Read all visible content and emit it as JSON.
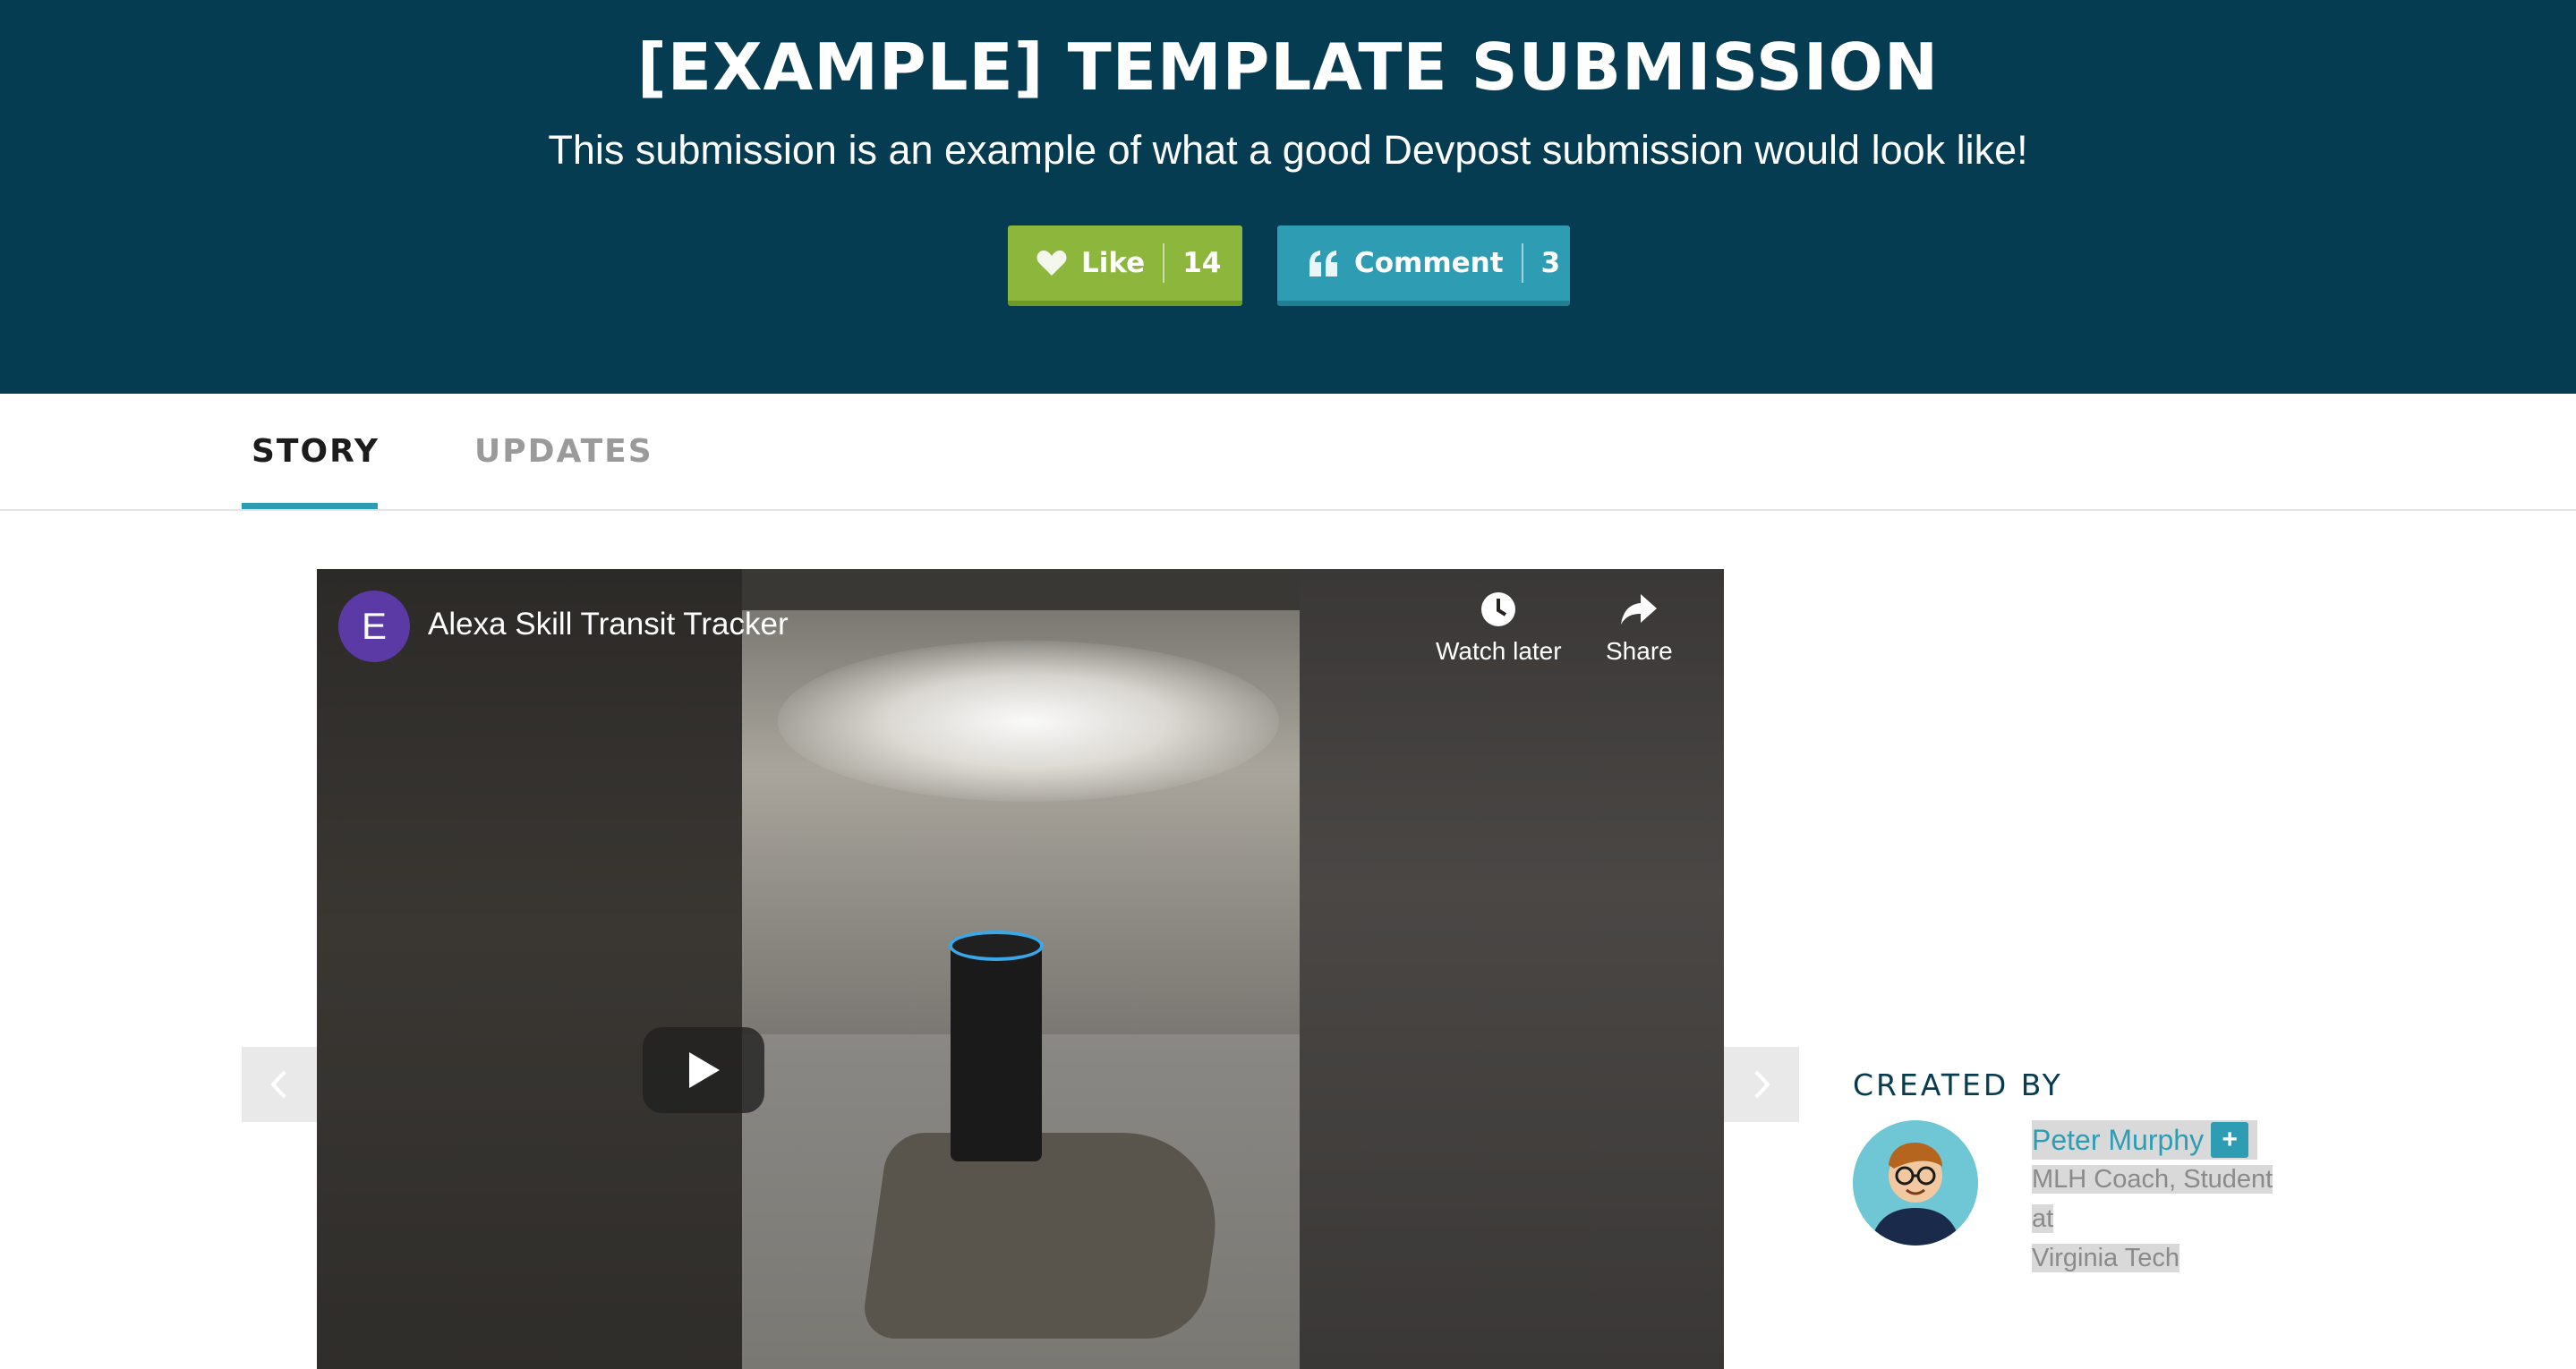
{
  "header": {
    "title": "[EXAMPLE] TEMPLATE SUBMISSION",
    "subtitle": "This submission is an example of what a good Devpost submission would look like!",
    "like": {
      "label": "Like",
      "count": "14",
      "icon": "heart-icon",
      "color": "#8cb63c"
    },
    "comment": {
      "label": "Comment",
      "count": "3",
      "icon": "quote-icon",
      "color": "#2e9db3"
    },
    "background": "#053c51"
  },
  "tabs": [
    {
      "label": "STORY",
      "active": true
    },
    {
      "label": "UPDATES",
      "active": false
    }
  ],
  "video": {
    "channel_initial": "E",
    "title": "Alexa Skill Transit Tracker",
    "watch_later": "Watch later",
    "share": "Share"
  },
  "creator": {
    "heading": "CREATED BY",
    "name": "Peter Murphy",
    "follow": "+",
    "bio_line1": "MLH Coach, Student at",
    "bio_line2": "Virginia Tech"
  }
}
